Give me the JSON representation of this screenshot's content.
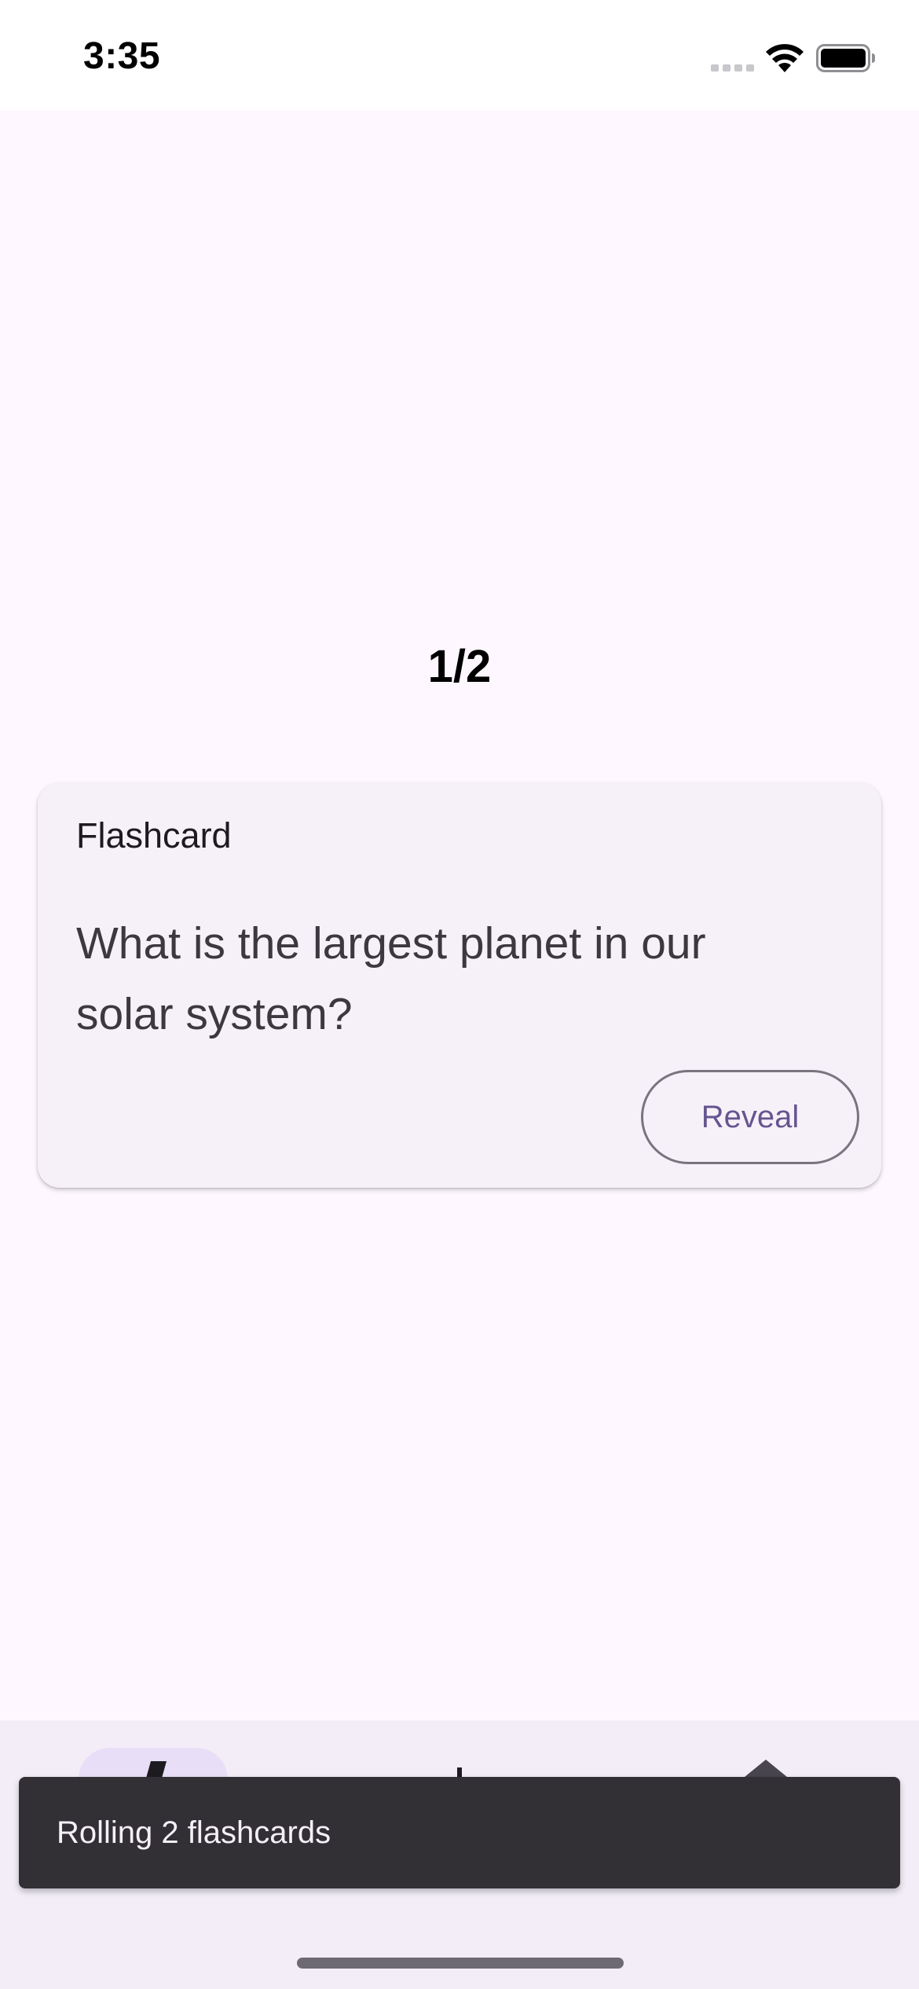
{
  "status_bar": {
    "time": "3:35"
  },
  "flashcards": {
    "counter": "1/2",
    "card_title": "Flashcard",
    "question": "What is the largest planet in our solar system?",
    "reveal_label": "Reveal"
  },
  "snackbar": {
    "message": "Rolling 2 flashcards"
  },
  "icons": {
    "signal": "cellular-signal-icon",
    "wifi": "wifi-icon",
    "battery": "battery-icon",
    "nav_left": "flashcards-nav-icon",
    "nav_middle": "nav-icon",
    "nav_right": "nav-icon"
  },
  "colors": {
    "background": "#FEF7FF",
    "card": "#F6F1F8",
    "accent": "#65558F",
    "snackbar": "#322F35",
    "nav_indicator": "#E8DEF8"
  }
}
